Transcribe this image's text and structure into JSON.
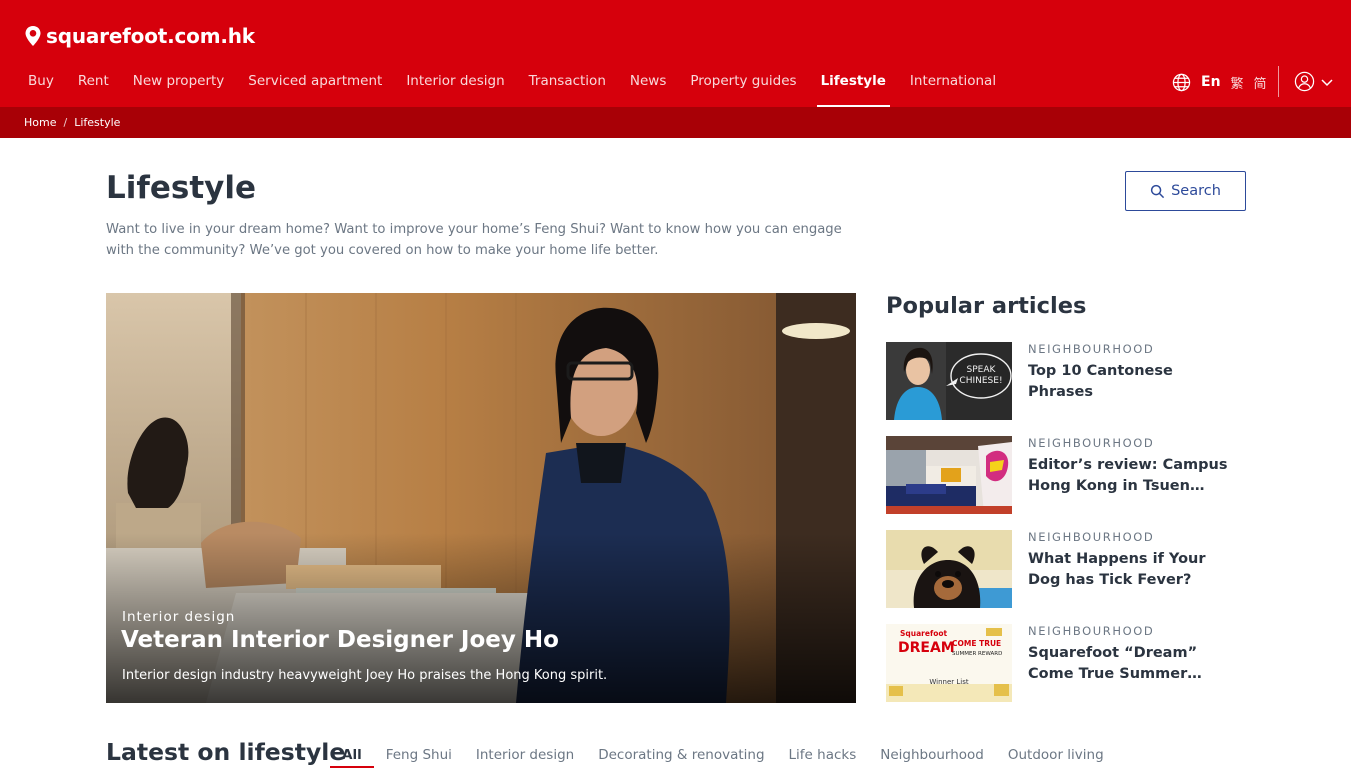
{
  "header": {
    "logo_text": "squarefoot.com.hk",
    "nav": [
      {
        "label": "Buy"
      },
      {
        "label": "Rent"
      },
      {
        "label": "New property"
      },
      {
        "label": "Serviced apartment"
      },
      {
        "label": "Interior design"
      },
      {
        "label": "Transaction"
      },
      {
        "label": "News"
      },
      {
        "label": "Property guides"
      },
      {
        "label": "Lifestyle",
        "active": true
      },
      {
        "label": "International"
      }
    ],
    "lang": {
      "en": "En",
      "trad": "繁",
      "simp": "简"
    },
    "brand_color": "#d6000c",
    "accent_color": "#2d4a9a"
  },
  "breadcrumb": {
    "home": "Home",
    "separator": "/",
    "current": "Lifestyle"
  },
  "page": {
    "title": "Lifestyle",
    "intro": "Want to live in your dream home? Want to improve your home’s Feng Shui? Want to know how you can engage with the community? We’ve got you covered on how to make your home life better.",
    "search_label": "Search"
  },
  "hero": {
    "category": "Interior design",
    "title": "Veteran Interior Designer Joey Ho",
    "description": "Interior design industry heavyweight Joey Ho praises the Hong Kong spirit."
  },
  "popular": {
    "heading": "Popular articles",
    "items": [
      {
        "category": "NEIGHBOURHOOD",
        "title": "Top 10 Cantonese Phrases",
        "thumb_text": "SPEAK CHINESE!"
      },
      {
        "category": "NEIGHBOURHOOD",
        "title": "Editor’s review: Campus Hong Kong in Tsuen…"
      },
      {
        "category": "NEIGHBOURHOOD",
        "title": "What Happens if Your Dog has Tick Fever?"
      },
      {
        "category": "NEIGHBOURHOOD",
        "title": "Squarefoot “Dream” Come True Summer…",
        "thumb_text": {
          "brand": "Squarefoot",
          "dream": "DREAM",
          "come_true": "COME TRUE",
          "reward": "SUMMER REWARD",
          "list": "Winner List"
        }
      }
    ]
  },
  "latest": {
    "heading": "Latest on lifestyle",
    "tabs": [
      {
        "label": "All",
        "active": true
      },
      {
        "label": "Feng Shui"
      },
      {
        "label": "Interior design"
      },
      {
        "label": "Decorating & renovating"
      },
      {
        "label": "Life hacks"
      },
      {
        "label": "Neighbourhood"
      },
      {
        "label": "Outdoor living"
      }
    ]
  }
}
